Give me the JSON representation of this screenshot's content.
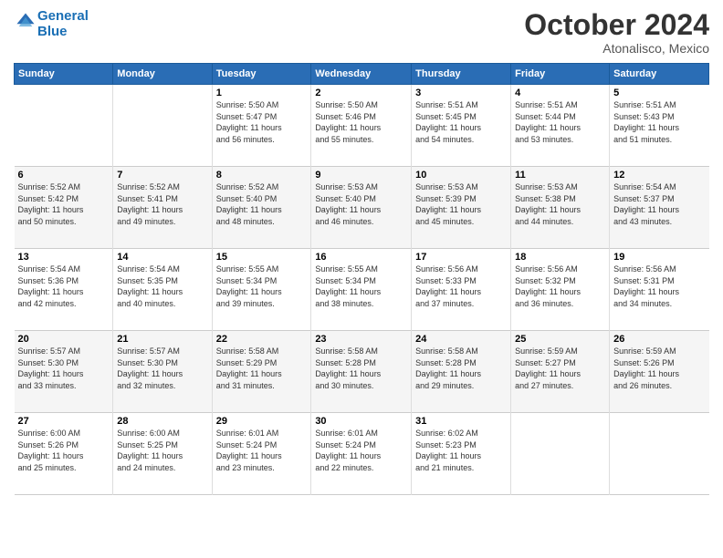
{
  "logo": {
    "line1": "General",
    "line2": "Blue"
  },
  "title": "October 2024",
  "subtitle": "Atonalisco, Mexico",
  "days_header": [
    "Sunday",
    "Monday",
    "Tuesday",
    "Wednesday",
    "Thursday",
    "Friday",
    "Saturday"
  ],
  "weeks": [
    [
      {
        "day": "",
        "info": ""
      },
      {
        "day": "",
        "info": ""
      },
      {
        "day": "1",
        "info": "Sunrise: 5:50 AM\nSunset: 5:47 PM\nDaylight: 11 hours\nand 56 minutes."
      },
      {
        "day": "2",
        "info": "Sunrise: 5:50 AM\nSunset: 5:46 PM\nDaylight: 11 hours\nand 55 minutes."
      },
      {
        "day": "3",
        "info": "Sunrise: 5:51 AM\nSunset: 5:45 PM\nDaylight: 11 hours\nand 54 minutes."
      },
      {
        "day": "4",
        "info": "Sunrise: 5:51 AM\nSunset: 5:44 PM\nDaylight: 11 hours\nand 53 minutes."
      },
      {
        "day": "5",
        "info": "Sunrise: 5:51 AM\nSunset: 5:43 PM\nDaylight: 11 hours\nand 51 minutes."
      }
    ],
    [
      {
        "day": "6",
        "info": "Sunrise: 5:52 AM\nSunset: 5:42 PM\nDaylight: 11 hours\nand 50 minutes."
      },
      {
        "day": "7",
        "info": "Sunrise: 5:52 AM\nSunset: 5:41 PM\nDaylight: 11 hours\nand 49 minutes."
      },
      {
        "day": "8",
        "info": "Sunrise: 5:52 AM\nSunset: 5:40 PM\nDaylight: 11 hours\nand 48 minutes."
      },
      {
        "day": "9",
        "info": "Sunrise: 5:53 AM\nSunset: 5:40 PM\nDaylight: 11 hours\nand 46 minutes."
      },
      {
        "day": "10",
        "info": "Sunrise: 5:53 AM\nSunset: 5:39 PM\nDaylight: 11 hours\nand 45 minutes."
      },
      {
        "day": "11",
        "info": "Sunrise: 5:53 AM\nSunset: 5:38 PM\nDaylight: 11 hours\nand 44 minutes."
      },
      {
        "day": "12",
        "info": "Sunrise: 5:54 AM\nSunset: 5:37 PM\nDaylight: 11 hours\nand 43 minutes."
      }
    ],
    [
      {
        "day": "13",
        "info": "Sunrise: 5:54 AM\nSunset: 5:36 PM\nDaylight: 11 hours\nand 42 minutes."
      },
      {
        "day": "14",
        "info": "Sunrise: 5:54 AM\nSunset: 5:35 PM\nDaylight: 11 hours\nand 40 minutes."
      },
      {
        "day": "15",
        "info": "Sunrise: 5:55 AM\nSunset: 5:34 PM\nDaylight: 11 hours\nand 39 minutes."
      },
      {
        "day": "16",
        "info": "Sunrise: 5:55 AM\nSunset: 5:34 PM\nDaylight: 11 hours\nand 38 minutes."
      },
      {
        "day": "17",
        "info": "Sunrise: 5:56 AM\nSunset: 5:33 PM\nDaylight: 11 hours\nand 37 minutes."
      },
      {
        "day": "18",
        "info": "Sunrise: 5:56 AM\nSunset: 5:32 PM\nDaylight: 11 hours\nand 36 minutes."
      },
      {
        "day": "19",
        "info": "Sunrise: 5:56 AM\nSunset: 5:31 PM\nDaylight: 11 hours\nand 34 minutes."
      }
    ],
    [
      {
        "day": "20",
        "info": "Sunrise: 5:57 AM\nSunset: 5:30 PM\nDaylight: 11 hours\nand 33 minutes."
      },
      {
        "day": "21",
        "info": "Sunrise: 5:57 AM\nSunset: 5:30 PM\nDaylight: 11 hours\nand 32 minutes."
      },
      {
        "day": "22",
        "info": "Sunrise: 5:58 AM\nSunset: 5:29 PM\nDaylight: 11 hours\nand 31 minutes."
      },
      {
        "day": "23",
        "info": "Sunrise: 5:58 AM\nSunset: 5:28 PM\nDaylight: 11 hours\nand 30 minutes."
      },
      {
        "day": "24",
        "info": "Sunrise: 5:58 AM\nSunset: 5:28 PM\nDaylight: 11 hours\nand 29 minutes."
      },
      {
        "day": "25",
        "info": "Sunrise: 5:59 AM\nSunset: 5:27 PM\nDaylight: 11 hours\nand 27 minutes."
      },
      {
        "day": "26",
        "info": "Sunrise: 5:59 AM\nSunset: 5:26 PM\nDaylight: 11 hours\nand 26 minutes."
      }
    ],
    [
      {
        "day": "27",
        "info": "Sunrise: 6:00 AM\nSunset: 5:26 PM\nDaylight: 11 hours\nand 25 minutes."
      },
      {
        "day": "28",
        "info": "Sunrise: 6:00 AM\nSunset: 5:25 PM\nDaylight: 11 hours\nand 24 minutes."
      },
      {
        "day": "29",
        "info": "Sunrise: 6:01 AM\nSunset: 5:24 PM\nDaylight: 11 hours\nand 23 minutes."
      },
      {
        "day": "30",
        "info": "Sunrise: 6:01 AM\nSunset: 5:24 PM\nDaylight: 11 hours\nand 22 minutes."
      },
      {
        "day": "31",
        "info": "Sunrise: 6:02 AM\nSunset: 5:23 PM\nDaylight: 11 hours\nand 21 minutes."
      },
      {
        "day": "",
        "info": ""
      },
      {
        "day": "",
        "info": ""
      }
    ]
  ]
}
